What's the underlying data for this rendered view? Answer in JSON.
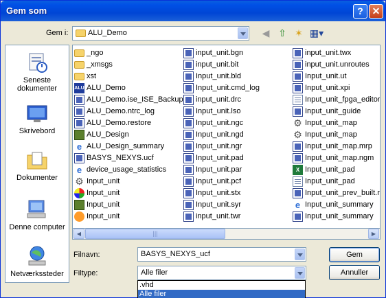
{
  "window": {
    "title": "Gem som",
    "help_label": "?",
    "close_label": "✕"
  },
  "toolbar": {
    "look_in_label": "Gem i:",
    "look_in_value": "ALU_Demo",
    "back_icon": "back-arrow-icon",
    "up_icon": "up-folder-icon",
    "new_folder_icon": "new-folder-icon",
    "views_icon": "views-menu-icon"
  },
  "places": [
    {
      "label": "Seneste dokumenter",
      "icon": "recent-documents-icon"
    },
    {
      "label": "Skrivebord",
      "icon": "desktop-icon"
    },
    {
      "label": "Dokumenter",
      "icon": "documents-icon"
    },
    {
      "label": "Denne computer",
      "icon": "my-computer-icon"
    },
    {
      "label": "Netværkssteder",
      "icon": "network-places-icon"
    }
  ],
  "files": {
    "col1": [
      {
        "name": "_ngo",
        "icon": "folder"
      },
      {
        "name": "_xmsgs",
        "icon": "folder"
      },
      {
        "name": "xst",
        "icon": "folder"
      },
      {
        "name": "ALU_Demo",
        "icon": "alu"
      },
      {
        "name": "ALU_Demo.ise_ISE_Backup",
        "icon": "grid"
      },
      {
        "name": "ALU_Demo.ntrc_log",
        "icon": "grid"
      },
      {
        "name": "ALU_Demo.restore",
        "icon": "grid"
      },
      {
        "name": "ALU_Design",
        "icon": "chip"
      },
      {
        "name": "ALU_Design_summary",
        "icon": "ie"
      },
      {
        "name": "BASYS_NEXYS.ucf",
        "icon": "grid"
      },
      {
        "name": "device_usage_statistics",
        "icon": "ie"
      },
      {
        "name": "Input_unit",
        "icon": "gear"
      },
      {
        "name": "Input_unit",
        "icon": "color"
      },
      {
        "name": "Input_unit",
        "icon": "chip"
      },
      {
        "name": "Input_unit",
        "icon": "orange"
      }
    ],
    "col2": [
      {
        "name": "input_unit.bgn",
        "icon": "grid"
      },
      {
        "name": "input_unit.bit",
        "icon": "grid"
      },
      {
        "name": "Input_unit.bld",
        "icon": "grid"
      },
      {
        "name": "Input_unit.cmd_log",
        "icon": "grid"
      },
      {
        "name": "input_unit.drc",
        "icon": "grid"
      },
      {
        "name": "Input_unit.lso",
        "icon": "grid"
      },
      {
        "name": "Input_unit.ngc",
        "icon": "grid"
      },
      {
        "name": "Input_unit.ngd",
        "icon": "grid"
      },
      {
        "name": "Input_unit.ngr",
        "icon": "grid"
      },
      {
        "name": "Input_unit.pad",
        "icon": "grid"
      },
      {
        "name": "Input_unit.par",
        "icon": "grid"
      },
      {
        "name": "Input_unit.pcf",
        "icon": "grid"
      },
      {
        "name": "Input_unit.stx",
        "icon": "grid"
      },
      {
        "name": "Input_unit.syr",
        "icon": "grid"
      },
      {
        "name": "input_unit.twr",
        "icon": "grid"
      }
    ],
    "col3": [
      {
        "name": "input_unit.twx",
        "icon": "grid"
      },
      {
        "name": "input_unit.unroutes",
        "icon": "grid"
      },
      {
        "name": "Input_unit.ut",
        "icon": "grid"
      },
      {
        "name": "Input_unit.xpi",
        "icon": "grid"
      },
      {
        "name": "Input_unit_fpga_editor",
        "icon": "doc"
      },
      {
        "name": "Input_unit_guide",
        "icon": "grid"
      },
      {
        "name": "Input_unit_map",
        "icon": "gear"
      },
      {
        "name": "Input_unit_map",
        "icon": "gear"
      },
      {
        "name": "Input_unit_map.mrp",
        "icon": "grid"
      },
      {
        "name": "Input_unit_map.ngm",
        "icon": "grid"
      },
      {
        "name": "Input_unit_pad",
        "icon": "xl"
      },
      {
        "name": "Input_unit_pad",
        "icon": "doc"
      },
      {
        "name": "Input_unit_prev_built.n",
        "icon": "grid"
      },
      {
        "name": "Input_unit_summary",
        "icon": "ie"
      },
      {
        "name": "Input_unit_summary",
        "icon": "grid"
      }
    ]
  },
  "filename": {
    "label": "Filnavn:",
    "value": "BASYS_NEXYS_ucf"
  },
  "filetype": {
    "label": "Filtype:",
    "value": "Alle filer",
    "options": [
      ".vhd",
      "Alle filer"
    ]
  },
  "buttons": {
    "save": "Gem",
    "cancel": "Annuller"
  },
  "colors": {
    "accent": "#0050e6",
    "selection": "#316ac5"
  }
}
